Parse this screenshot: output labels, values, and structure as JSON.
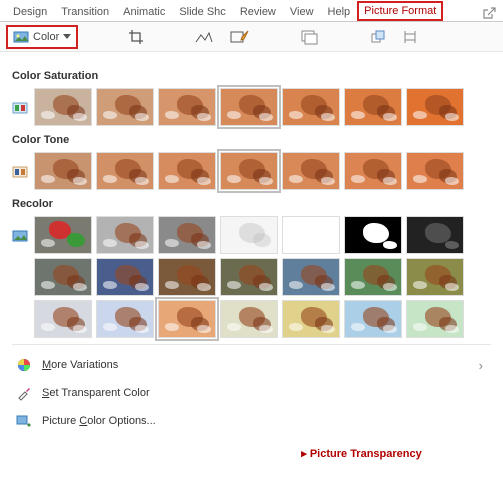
{
  "ribbon": {
    "tabs": [
      "Design",
      "Transition",
      "Animatic",
      "Slide Shc",
      "Review",
      "View",
      "Help",
      "Picture Format"
    ]
  },
  "toolbar": {
    "color_label": "Color"
  },
  "dropdown": {
    "sections": {
      "saturation": {
        "title": "Color Saturation"
      },
      "tone": {
        "title": "Color Tone"
      },
      "recolor": {
        "title": "Recolor"
      }
    },
    "saturation": {
      "swatches": [
        {
          "bg": "#c9b39f"
        },
        {
          "bg": "#cf9e78"
        },
        {
          "bg": "#d6956a"
        },
        {
          "bg": "#d68a5a",
          "selected": true
        },
        {
          "bg": "#d9844e"
        },
        {
          "bg": "#dd7c40"
        },
        {
          "bg": "#e17230"
        }
      ]
    },
    "tone": {
      "swatches": [
        {
          "bg": "#c89470"
        },
        {
          "bg": "#d29066"
        },
        {
          "bg": "#d68c5e"
        },
        {
          "bg": "#d68a5a",
          "selected": true
        },
        {
          "bg": "#d98858"
        },
        {
          "bg": "#dc8452"
        },
        {
          "bg": "#df804c"
        }
      ]
    },
    "recolor": {
      "rows": [
        [
          {
            "bg": "#6fa03a",
            "overlay": "color"
          },
          {
            "bg": "#b3b3b3"
          },
          {
            "bg": "#8a8a8a"
          },
          {
            "bg": "#f5f5f5",
            "light": true
          },
          {
            "bg": "#ffffff",
            "bw": true
          },
          {
            "bg": "#000000",
            "bw": true
          },
          {
            "bg": "#222222",
            "dark": true
          }
        ],
        [
          {
            "bg": "#6e756e"
          },
          {
            "bg": "#4a5e8e"
          },
          {
            "bg": "#7a5a3a"
          },
          {
            "bg": "#6b6b50"
          },
          {
            "bg": "#5f7f9c"
          },
          {
            "bg": "#5a8c5a"
          },
          {
            "bg": "#8c8c4a"
          }
        ],
        [
          {
            "bg": "#d6d9e0"
          },
          {
            "bg": "#c9d6ec"
          },
          {
            "bg": "#e8a777",
            "selected": true
          },
          {
            "bg": "#e0e0c8"
          },
          {
            "bg": "#e0d28a"
          },
          {
            "bg": "#aacfe6"
          },
          {
            "bg": "#c6e4c6"
          }
        ]
      ]
    },
    "commands": {
      "more_variations": "More Variations",
      "set_transparent": "Set Transparent Color",
      "picture_color_options": "Picture Color Options..."
    }
  },
  "footer": {
    "transparency": "Picture Transparency"
  }
}
